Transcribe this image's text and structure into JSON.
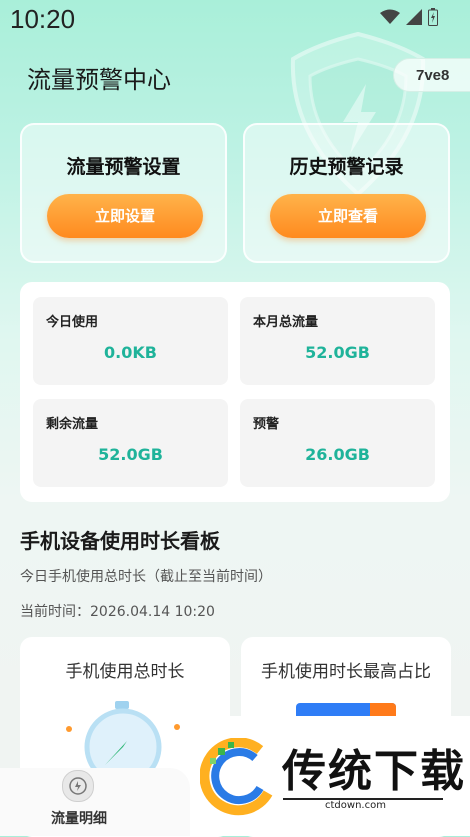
{
  "status_bar": {
    "time": "10:20",
    "icons": [
      "wifi-icon",
      "signal-icon",
      "battery-icon"
    ]
  },
  "header": {
    "title": "流量预警中心",
    "version": "7ve8"
  },
  "cards": [
    {
      "title": "流量预警设置",
      "button": "立即设置"
    },
    {
      "title": "历史预警记录",
      "button": "立即查看"
    }
  ],
  "stats": [
    {
      "label": "今日使用",
      "value": "0.0KB"
    },
    {
      "label": "本月总流量",
      "value": "52.0GB"
    },
    {
      "label": "剩余流量",
      "value": "52.0GB"
    },
    {
      "label": "预警",
      "value": "26.0GB"
    }
  ],
  "dashboard": {
    "title": "手机设备使用时长看板",
    "subtitle": "今日手机使用总时长（截止至当前时间）",
    "current_time": "当前时间：2026.04.14 10:20",
    "cards": [
      "手机使用总时长",
      "手机使用时长最高占比"
    ]
  },
  "bottom_nav": {
    "label": "流量明细"
  },
  "watermark": {
    "brand": "传统下载",
    "url": "ctdown.com"
  },
  "colors": {
    "accent": "#1fb39a",
    "button": "#ff9a2e"
  }
}
